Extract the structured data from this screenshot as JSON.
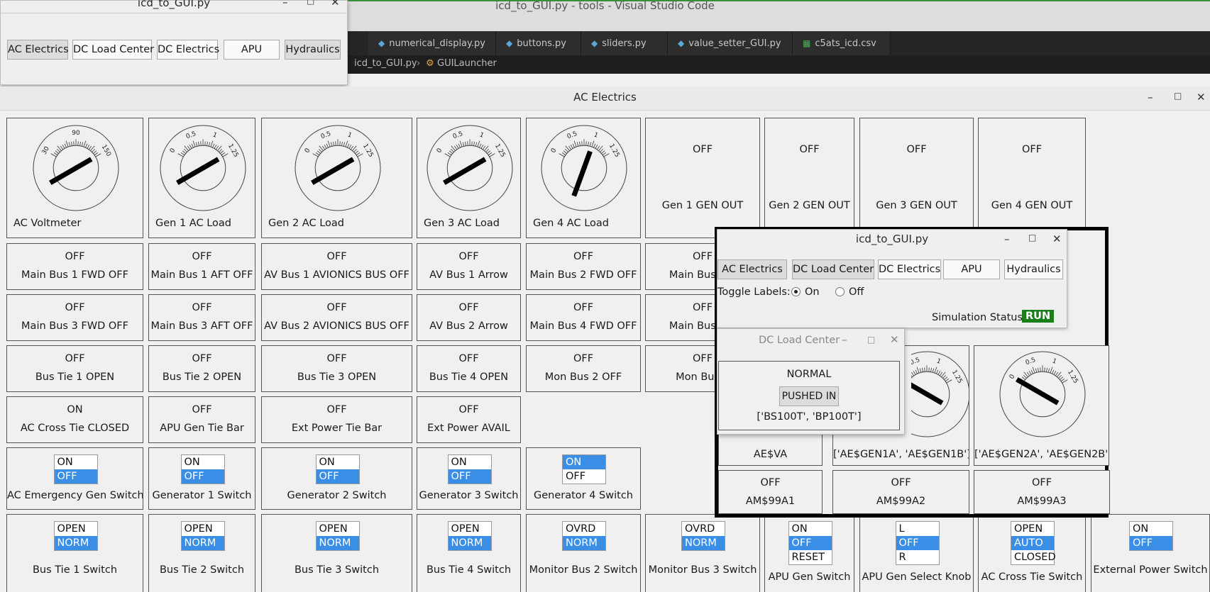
{
  "vscode": {
    "title": "icd_to_GUI.py - tools - Visual Studio Code",
    "tabs": [
      "numerical_display.py",
      "buttons.py",
      "sliders.py",
      "value_setter_GUI.py",
      "c5ats_icd.csv"
    ],
    "breadcrumb": {
      "file": "icd_to_GUI.py",
      "symbol": "GUILauncher"
    }
  },
  "launcher": {
    "title": "icd_to_GUI.py",
    "buttons": [
      "AC Electrics",
      "DC Load Center",
      "DC Electrics",
      "APU",
      "Hydraulics"
    ]
  },
  "ac_window": {
    "title": "AC Electrics"
  },
  "dials": [
    {
      "label": "AC Voltmeter",
      "ticks": [
        "30",
        "90",
        "150"
      ]
    },
    {
      "label": "Gen 1 AC Load",
      "ticks": [
        "0",
        "0.5",
        "1",
        "1.25"
      ]
    },
    {
      "label": "Gen 2 AC Load",
      "ticks": [
        "0",
        "0.5",
        "1",
        "1.25"
      ]
    },
    {
      "label": "Gen 3 AC Load",
      "ticks": [
        "0",
        "0.5",
        "1",
        "1.25"
      ]
    },
    {
      "label": "Gen 4 AC Load",
      "ticks": [
        "0",
        "0.5",
        "1",
        "1.25"
      ]
    }
  ],
  "gen_out": [
    {
      "value": "OFF",
      "label": "Gen 1 GEN OUT"
    },
    {
      "value": "OFF",
      "label": "Gen 2 GEN OUT"
    },
    {
      "value": "OFF",
      "label": "Gen 3 GEN OUT"
    },
    {
      "value": "OFF",
      "label": "Gen 4 GEN OUT"
    }
  ],
  "indicators": [
    [
      {
        "v": "OFF",
        "l": "Main Bus 1 FWD OFF"
      },
      {
        "v": "OFF",
        "l": "Main Bus 1 AFT OFF"
      },
      {
        "v": "OFF",
        "l": "AV Bus 1 AVIONICS BUS OFF"
      },
      {
        "v": "OFF",
        "l": "AV Bus 1 Arrow"
      },
      {
        "v": "OFF",
        "l": "Main Bus 2 FWD OFF"
      },
      {
        "v": "OFF",
        "l": "Main Bus 2 A"
      }
    ],
    [
      {
        "v": "OFF",
        "l": "Main Bus 3 FWD OFF"
      },
      {
        "v": "OFF",
        "l": "Main Bus 3 AFT OFF"
      },
      {
        "v": "OFF",
        "l": "AV Bus 2 AVIONICS BUS OFF"
      },
      {
        "v": "OFF",
        "l": "AV Bus 2 Arrow"
      },
      {
        "v": "OFF",
        "l": "Main Bus 4 FWD OFF"
      },
      {
        "v": "OFF",
        "l": "Main Bus 4 A"
      }
    ],
    [
      {
        "v": "OFF",
        "l": "Bus Tie 1 OPEN"
      },
      {
        "v": "OFF",
        "l": "Bus Tie 2 OPEN"
      },
      {
        "v": "OFF",
        "l": "Bus Tie 3 OPEN"
      },
      {
        "v": "OFF",
        "l": "Bus Tie 4 OPEN"
      },
      {
        "v": "OFF",
        "l": "Mon Bus 2 OFF"
      },
      {
        "v": "OFF",
        "l": "Mon Bus 3"
      }
    ],
    [
      {
        "v": "ON",
        "l": "AC Cross Tie CLOSED"
      },
      {
        "v": "OFF",
        "l": "APU Gen Tie Bar"
      },
      {
        "v": "OFF",
        "l": "Ext Power Tie Bar"
      },
      {
        "v": "OFF",
        "l": "Ext Power AVAIL"
      }
    ]
  ],
  "switches": [
    {
      "label": "AC Emergency Gen Switch",
      "options": [
        "ON",
        "OFF"
      ],
      "selected": 1
    },
    {
      "label": "Generator 1 Switch",
      "options": [
        "ON",
        "OFF"
      ],
      "selected": 1
    },
    {
      "label": "Generator 2 Switch",
      "options": [
        "ON",
        "OFF"
      ],
      "selected": 1
    },
    {
      "label": "Generator 3 Switch",
      "options": [
        "ON",
        "OFF"
      ],
      "selected": 1
    },
    {
      "label": "Generator 4 Switch",
      "options": [
        "ON",
        "OFF"
      ],
      "selected": 0
    }
  ],
  "bottom_switches": [
    {
      "label": "Bus Tie 1 Switch",
      "options": [
        "OPEN",
        "NORM"
      ],
      "selected": 1
    },
    {
      "label": "Bus Tie 2 Switch",
      "options": [
        "OPEN",
        "NORM"
      ],
      "selected": 1
    },
    {
      "label": "Bus Tie 3 Switch",
      "options": [
        "OPEN",
        "NORM"
      ],
      "selected": 1
    },
    {
      "label": "Bus Tie 4 Switch",
      "options": [
        "OPEN",
        "NORM"
      ],
      "selected": 1
    },
    {
      "label": "Monitor Bus 2 Switch",
      "options": [
        "OVRD",
        "NORM"
      ],
      "selected": 1
    },
    {
      "label": "Monitor Bus 3 Switch",
      "options": [
        "OVRD",
        "NORM"
      ],
      "selected": 1
    },
    {
      "label": "APU Gen Switch",
      "options": [
        "ON",
        "OFF",
        "RESET"
      ],
      "selected": 1
    },
    {
      "label": "APU Gen Select Knob",
      "options": [
        "L",
        "OFF",
        "R"
      ],
      "selected": 1
    },
    {
      "label": "AC Cross Tie Switch",
      "options": [
        "OPEN",
        "AUTO",
        "CLOSED"
      ],
      "selected": 1
    },
    {
      "label": "External Power Switch",
      "options": [
        "ON",
        "OFF"
      ],
      "selected": 1
    }
  ],
  "overlay_launcher": {
    "title": "icd_to_GUI.py",
    "buttons": [
      "AC Electrics",
      "DC Load Center",
      "DC Electrics",
      "APU",
      "Hydraulics"
    ],
    "toggle_label": "Toggle Labels:",
    "toggle_on": "On",
    "toggle_off": "Off",
    "toggle_selected": "On",
    "status_label": "Simulation Status:",
    "status_value": "RUN"
  },
  "dc_window": {
    "title": "DC Load Center",
    "state": "NORMAL",
    "button": "PUSHED IN",
    "ids": "['BS100T', 'BP100T']"
  },
  "overlay_cells": {
    "dials": [
      {
        "label": "AE$VA"
      },
      {
        "label": "['AE$GEN1A', 'AE$GEN1B']"
      },
      {
        "label": "['AE$GEN2A', 'AE$GEN2B']",
        "ticks": [
          "0",
          "0.5",
          "1",
          "1.25"
        ]
      }
    ],
    "indicators": [
      {
        "v": "OFF",
        "l": "AM$99A1"
      },
      {
        "v": "OFF",
        "l": "AM$99A2"
      },
      {
        "v": "OFF",
        "l": "AM$99A3"
      }
    ]
  },
  "colors": {
    "selected": "#3a8ee6",
    "run": "#1a7f1a"
  }
}
